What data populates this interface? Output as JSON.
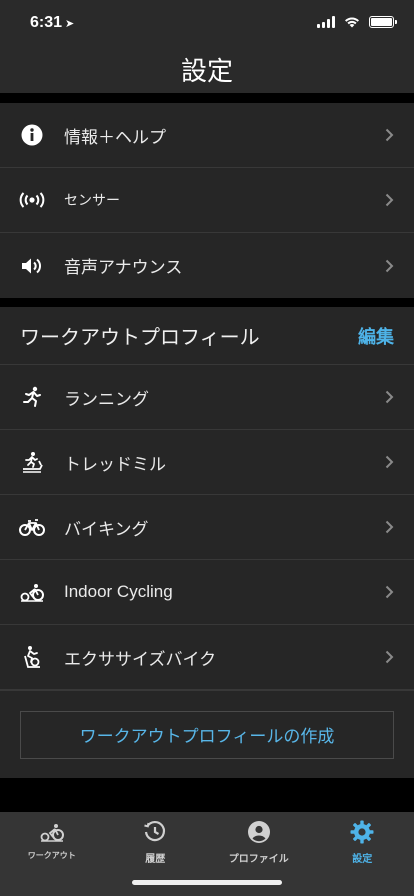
{
  "status": {
    "time": "6:31",
    "location_arrow": "➤"
  },
  "header": {
    "title": "設定"
  },
  "general": {
    "items": [
      {
        "label": "情報＋ヘルプ",
        "icon": "info-icon"
      },
      {
        "label": "センサー",
        "icon": "sensor-icon"
      },
      {
        "label": "音声アナウンス",
        "icon": "speaker-icon"
      }
    ]
  },
  "workout_profiles": {
    "title": "ワークアウトプロフィール",
    "edit_label": "編集",
    "items": [
      {
        "label": "ランニング",
        "icon": "running-icon"
      },
      {
        "label": "トレッドミル",
        "icon": "treadmill-icon"
      },
      {
        "label": "バイキング",
        "icon": "bike-icon"
      },
      {
        "label": "Indoor Cycling",
        "icon": "indoor-cycling-icon"
      },
      {
        "label": "エクササイズバイク",
        "icon": "exercise-bike-icon"
      }
    ],
    "create_label": "ワークアウトプロフィールの作成"
  },
  "tabs": [
    {
      "label": "ワークアウト",
      "icon": "workout-icon",
      "active": false
    },
    {
      "label": "履歴",
      "icon": "history-icon",
      "active": false
    },
    {
      "label": "プロファイル",
      "icon": "profile-icon",
      "active": false
    },
    {
      "label": "設定",
      "icon": "gear-icon",
      "active": true
    }
  ],
  "colors": {
    "accent": "#4eb3e8",
    "background": "#000000",
    "row_bg": "#262626",
    "tab_bg": "#353535"
  }
}
